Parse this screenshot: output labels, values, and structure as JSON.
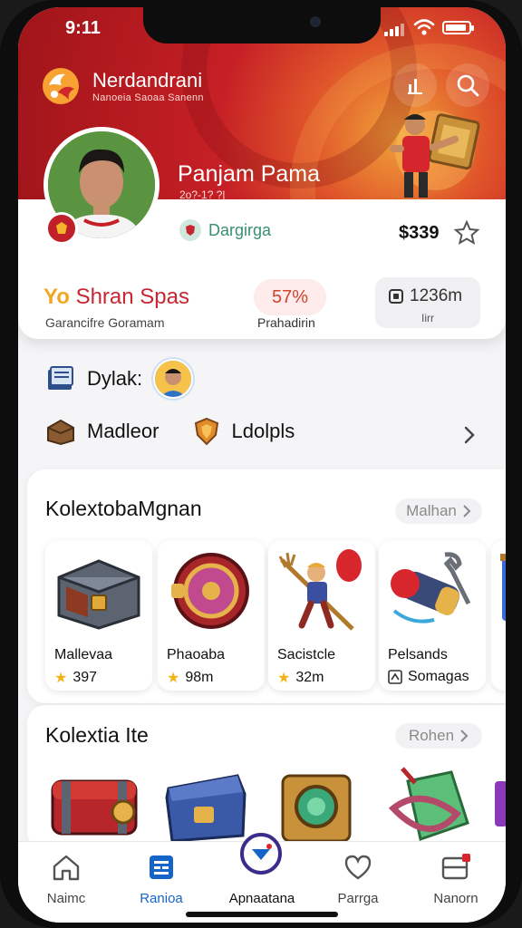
{
  "status": {
    "time": "9:11"
  },
  "header": {
    "brand": "Nerdandrani",
    "brand_sub": "Nanoeia Saoaa Sanenn",
    "profile_name": "Panjam Pama",
    "profile_sub": "2o?-1? ?|"
  },
  "profile_card": {
    "tag": "Dargirga",
    "price": "$339",
    "stat1": {
      "prefix": "Yo",
      "value": "Shran Spas",
      "label": "Garancifre Goramam"
    },
    "stat2": {
      "value": "57%",
      "label": "Prahadirin"
    },
    "stat3": {
      "value": "1236m",
      "label": "Iirr"
    }
  },
  "rows": {
    "row1_label": "Dylak:",
    "row2_left": "Madleor",
    "row2_right": "Ldolpls"
  },
  "section1": {
    "title": "KolextobaMgnan",
    "more": "Malhan",
    "items": [
      {
        "name": "Mallevaa",
        "price": "397"
      },
      {
        "name": "Phaoaba",
        "price": "98m"
      },
      {
        "name": "Sacistcle",
        "price": "32m"
      },
      {
        "name": "Pelsands",
        "price": "Somagas"
      }
    ]
  },
  "section2": {
    "title": "Kolextia Ite",
    "more": "Rohen"
  },
  "nav": {
    "items": [
      "Naimc",
      "Ranioa",
      "Apnaatana",
      "Parrga",
      "Nanorn"
    ],
    "active_index": 1
  },
  "colors": {
    "brand_red": "#c62026",
    "accent_blue": "#1565c8",
    "star": "#f2b319"
  }
}
